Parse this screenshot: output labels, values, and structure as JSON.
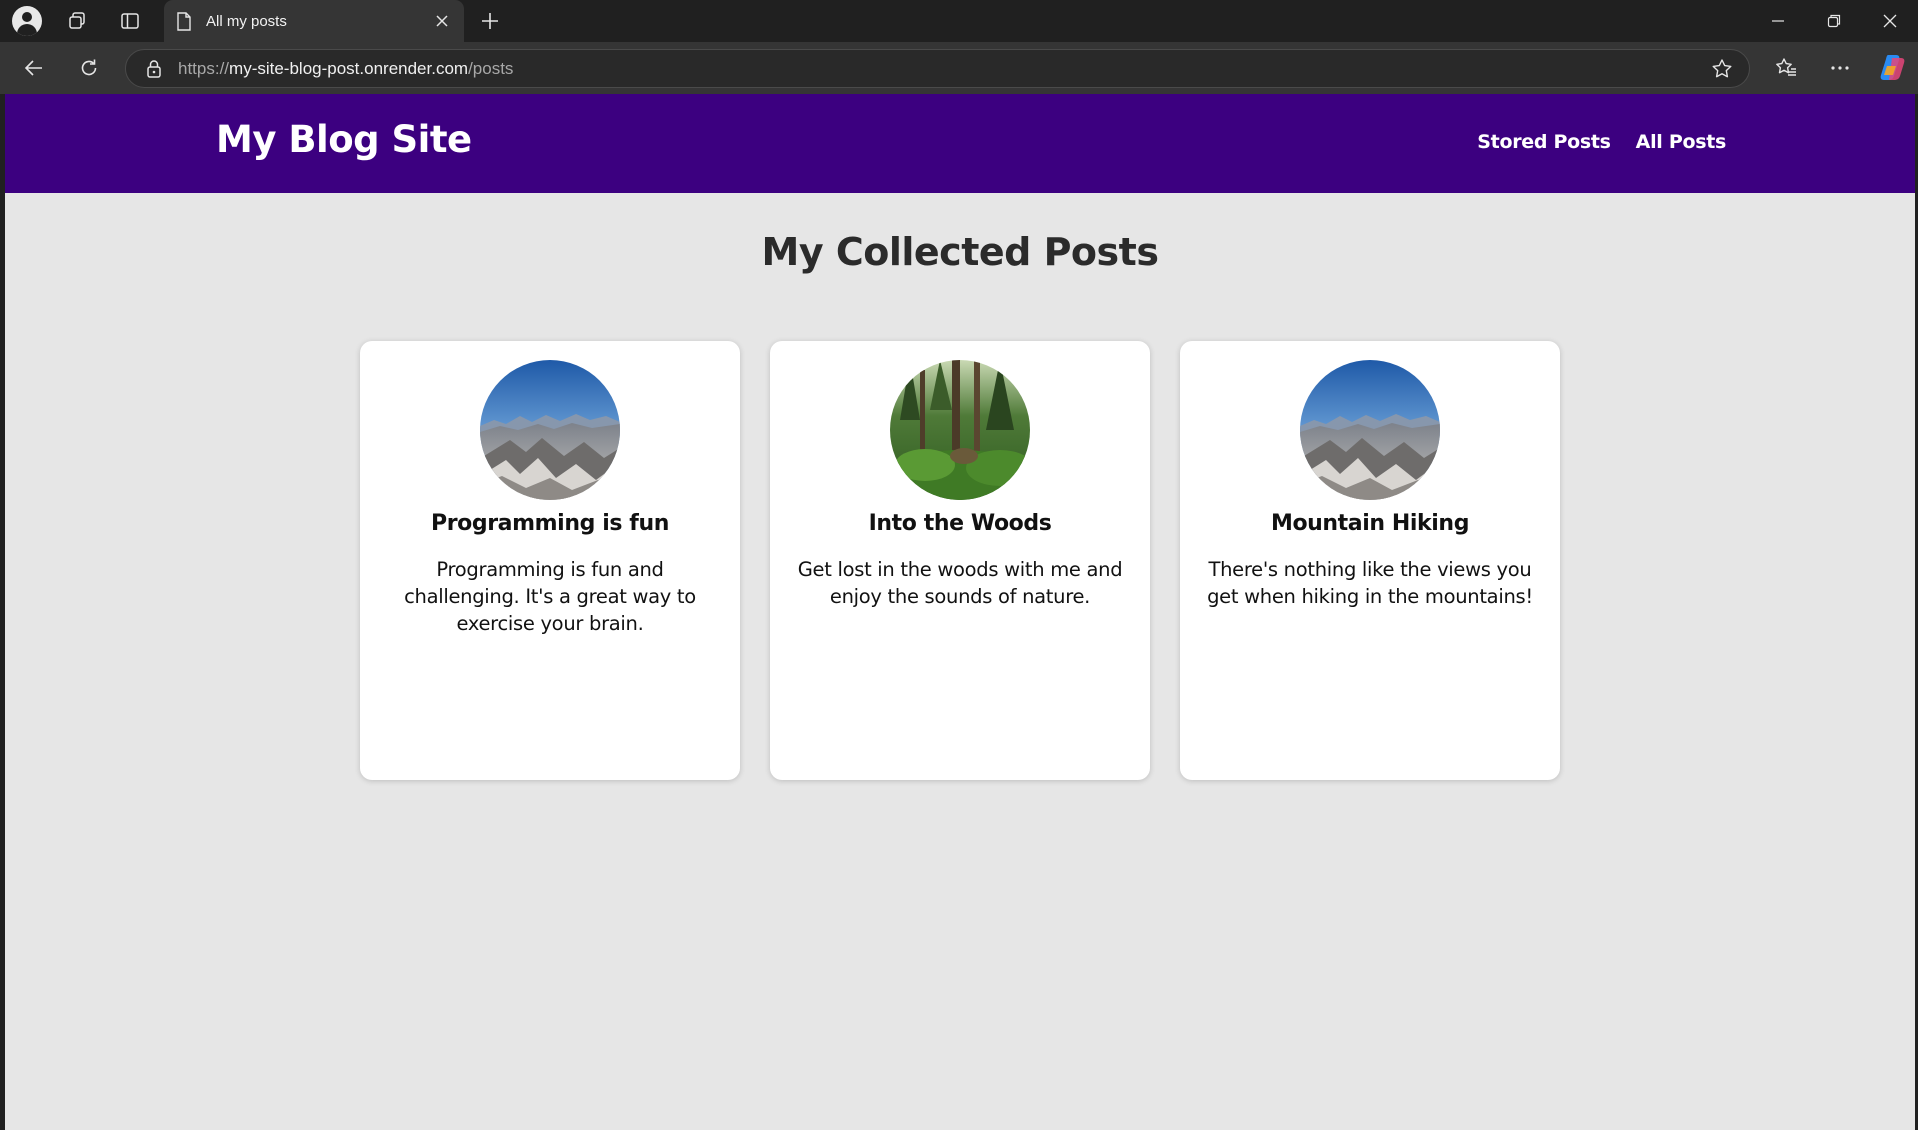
{
  "browser": {
    "tab_title": "All my posts",
    "url_prefix": "https://",
    "url_host": "my-site-blog-post.onrender.com",
    "url_path": "/posts"
  },
  "site": {
    "title": "My Blog Site",
    "nav": [
      "Stored Posts",
      "All Posts"
    ],
    "brand_color": "#3c0080"
  },
  "main": {
    "heading": "My Collected Posts",
    "posts": [
      {
        "image": "mountain-photo",
        "title": "Programming is fun",
        "summary": "Programming is fun and challenging. It's a great way to exercise your brain."
      },
      {
        "image": "forest-photo",
        "title": "Into the Woods",
        "summary": "Get lost in the woods with me and enjoy the sounds of nature."
      },
      {
        "image": "mountain-photo",
        "title": "Mountain Hiking",
        "summary": "There's nothing like the views you get when hiking in the mountains!"
      }
    ]
  }
}
